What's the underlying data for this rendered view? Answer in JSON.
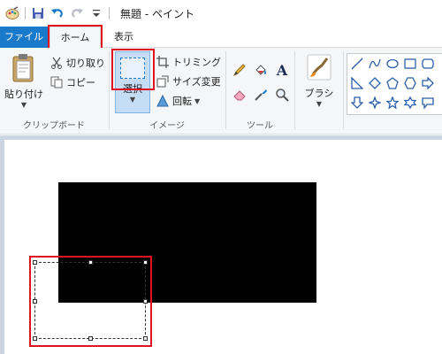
{
  "window": {
    "title": "無題 - ペイント"
  },
  "tabs": {
    "file": "ファイル",
    "home": "ホーム",
    "view": "表示"
  },
  "clipboard": {
    "paste": "貼り付け",
    "cut": "切り取り",
    "copy": "コピー",
    "label": "クリップボード"
  },
  "image": {
    "select": "選択",
    "crop": "トリミング",
    "resize": "サイズ変更",
    "rotate": "回転",
    "label": "イメージ"
  },
  "tools": {
    "label": "ツール",
    "text_glyph": "A"
  },
  "brush": {
    "label": "ブラシ"
  },
  "colors": {
    "accent": "#1979ca",
    "highlight": "#e0141e",
    "canvas_bg": "#ccd5e4",
    "ribbon_bg": "#f5f6f7"
  }
}
